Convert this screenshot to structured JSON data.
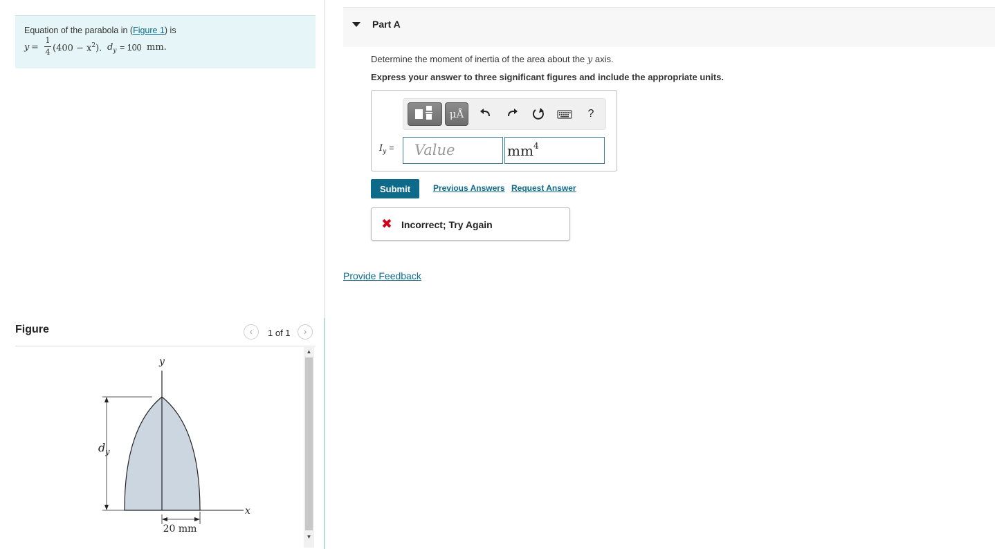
{
  "intro": {
    "line1_prefix": "Equation of the parabola in (",
    "figure_link": "Figure 1",
    "line1_suffix": ") is",
    "eq_y": "y",
    "eq_equals": "=",
    "eq_num": "1",
    "eq_den": "4",
    "eq_body": "(400 − x",
    "eq_pow": "2",
    "eq_close": ").",
    "eq_dy": "d",
    "eq_dy_sub": "y",
    "eq_dy_value": "= 100",
    "eq_unit": "mm."
  },
  "figure": {
    "title": "Figure",
    "counter": "1 of 1",
    "prev_icon": "chevron-left-icon",
    "next_icon": "chevron-right-icon",
    "label_y": "y",
    "label_x": "x",
    "label_d": "d",
    "label_d_sub": "y",
    "label_width": "20 mm",
    "fill_color": "#ccd6e0"
  },
  "part": {
    "title": "Part A",
    "question_prefix": "Determine the moment of inertia of the area about the",
    "question_var": "y",
    "question_suffix": "axis.",
    "instruction": "Express your answer to three significant figures and include the appropriate units."
  },
  "answer": {
    "label_main": "I",
    "label_sub": "y",
    "label_eq": "=",
    "value_placeholder": "Value",
    "unit": "mm",
    "unit_pow": "4",
    "toolbar": {
      "templates_icon": "templates-icon",
      "units_label": "μÅ",
      "undo_icon": "undo-icon",
      "redo_icon": "redo-icon",
      "reset_icon": "reset-icon",
      "keyboard_icon": "keyboard-icon",
      "help_label": "?"
    }
  },
  "actions": {
    "submit": "Submit",
    "previous_answers": "Previous Answers",
    "request_answer": "Request Answer"
  },
  "feedback": {
    "icon": "x-mark-icon",
    "message": "Incorrect; Try Again"
  },
  "provide_feedback": "Provide Feedback",
  "colors": {
    "accent": "#0e6a8b",
    "error": "#d0021b",
    "info_bg": "#e6f5f7"
  }
}
